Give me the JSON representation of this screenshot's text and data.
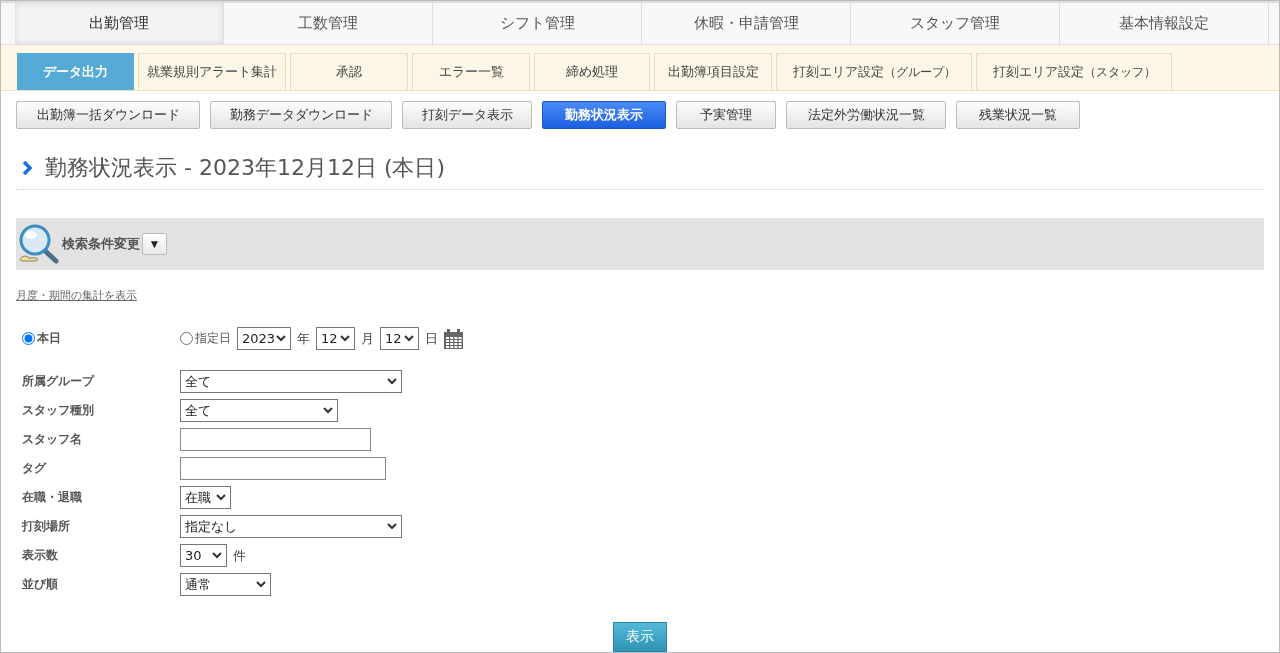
{
  "main_tabs": [
    {
      "label": "出勤管理",
      "selected": true
    },
    {
      "label": "工数管理",
      "selected": false
    },
    {
      "label": "シフト管理",
      "selected": false
    },
    {
      "label": "休暇・申請管理",
      "selected": false
    },
    {
      "label": "スタッフ管理",
      "selected": false
    },
    {
      "label": "基本情報設定",
      "selected": false
    }
  ],
  "sub_tabs": [
    {
      "label": "データ出力",
      "selected": true
    },
    {
      "label": "就業規則アラート集計",
      "selected": false
    },
    {
      "label": "承認",
      "selected": false
    },
    {
      "label": "エラー一覧",
      "selected": false
    },
    {
      "label": "締め処理",
      "selected": false
    },
    {
      "label": "出勤簿項目設定",
      "selected": false
    },
    {
      "label": "打刻エリア設定",
      "note": "（グループ）",
      "selected": false
    },
    {
      "label": "打刻エリア設定",
      "note": "（スタッフ）",
      "selected": false
    }
  ],
  "action_buttons": [
    {
      "label": "出勤簿一括ダウンロード",
      "selected": false
    },
    {
      "label": "勤務データダウンロード",
      "selected": false
    },
    {
      "label": "打刻データ表示",
      "selected": false
    },
    {
      "label": "勤務状況表示",
      "selected": true
    },
    {
      "label": "予実管理",
      "selected": false
    },
    {
      "label": "法定外労働状況一覧",
      "selected": false
    },
    {
      "label": "残業状況一覧",
      "selected": false
    }
  ],
  "page_title": "勤務状況表示 - 2023年12月12日 (本日)",
  "search_panel": {
    "title": "検索条件変更",
    "toggle": "▼"
  },
  "summary_link": "月度・期間の集計を表示",
  "date_choice": {
    "today": {
      "label": "本日",
      "selected": true
    },
    "specified": {
      "label": "指定日",
      "selected": false
    },
    "year": "2023",
    "year_unit": "年",
    "month": "12",
    "month_unit": "月",
    "day": "12",
    "day_unit": "日"
  },
  "form_rows": [
    {
      "label": "所属グループ",
      "kind": "select",
      "value": "全て"
    },
    {
      "label": "スタッフ種別",
      "kind": "select",
      "value": "全て"
    },
    {
      "label": "スタッフ名",
      "kind": "text"
    },
    {
      "label": "タグ",
      "kind": "text"
    },
    {
      "label": "在職・退職",
      "kind": "select",
      "value": "在職"
    },
    {
      "label": "打刻場所",
      "kind": "select",
      "value": "指定なし"
    },
    {
      "label": "表示数",
      "kind": "select",
      "value": "30",
      "unit": "件"
    },
    {
      "label": "並び順",
      "kind": "select",
      "value": "通常"
    }
  ],
  "submit": "表示"
}
